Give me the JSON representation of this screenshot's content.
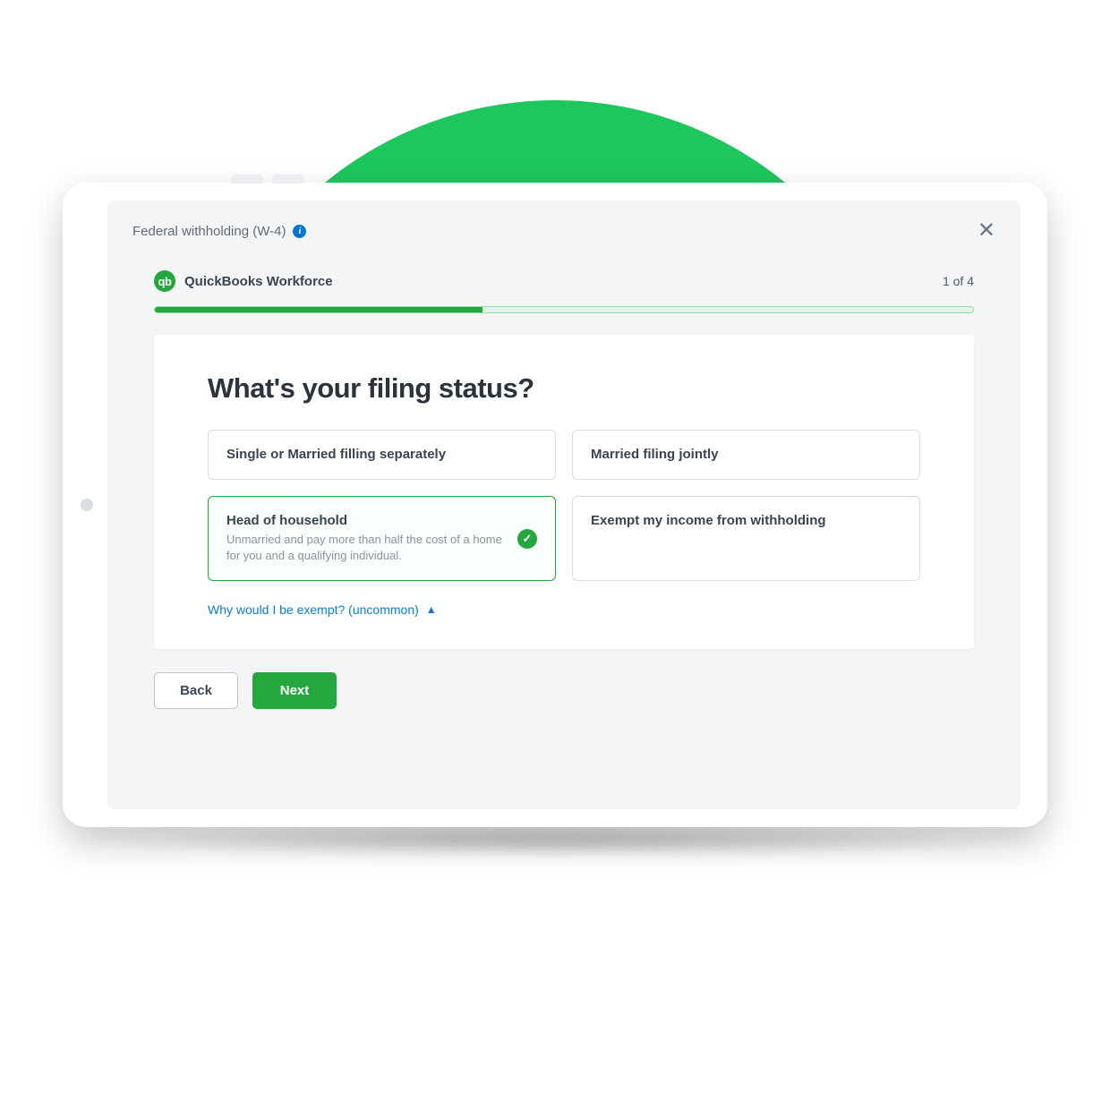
{
  "colors": {
    "accent_green": "#24a73e",
    "bg_green": "#1ec75e",
    "link_blue": "#0a7bd6"
  },
  "header": {
    "title": "Federal withholding (W-4)"
  },
  "brand": {
    "logo_text": "qb",
    "name": "QuickBooks Workforce"
  },
  "progress": {
    "step_label": "1 of 4",
    "percent": 40
  },
  "question": "What's your filing status?",
  "options": [
    {
      "title": "Single or Married filling separately",
      "sub": "",
      "selected": false
    },
    {
      "title": "Married filing jointly",
      "sub": "",
      "selected": false
    },
    {
      "title": "Head of household",
      "sub": "Unmarried and pay more than half the cost of a home for you and a qualifying individual.",
      "selected": true
    },
    {
      "title": "Exempt my income from withholding",
      "sub": "",
      "selected": false
    }
  ],
  "exempt_link": "Why would I be exempt? (uncommon)",
  "buttons": {
    "back": "Back",
    "next": "Next"
  }
}
